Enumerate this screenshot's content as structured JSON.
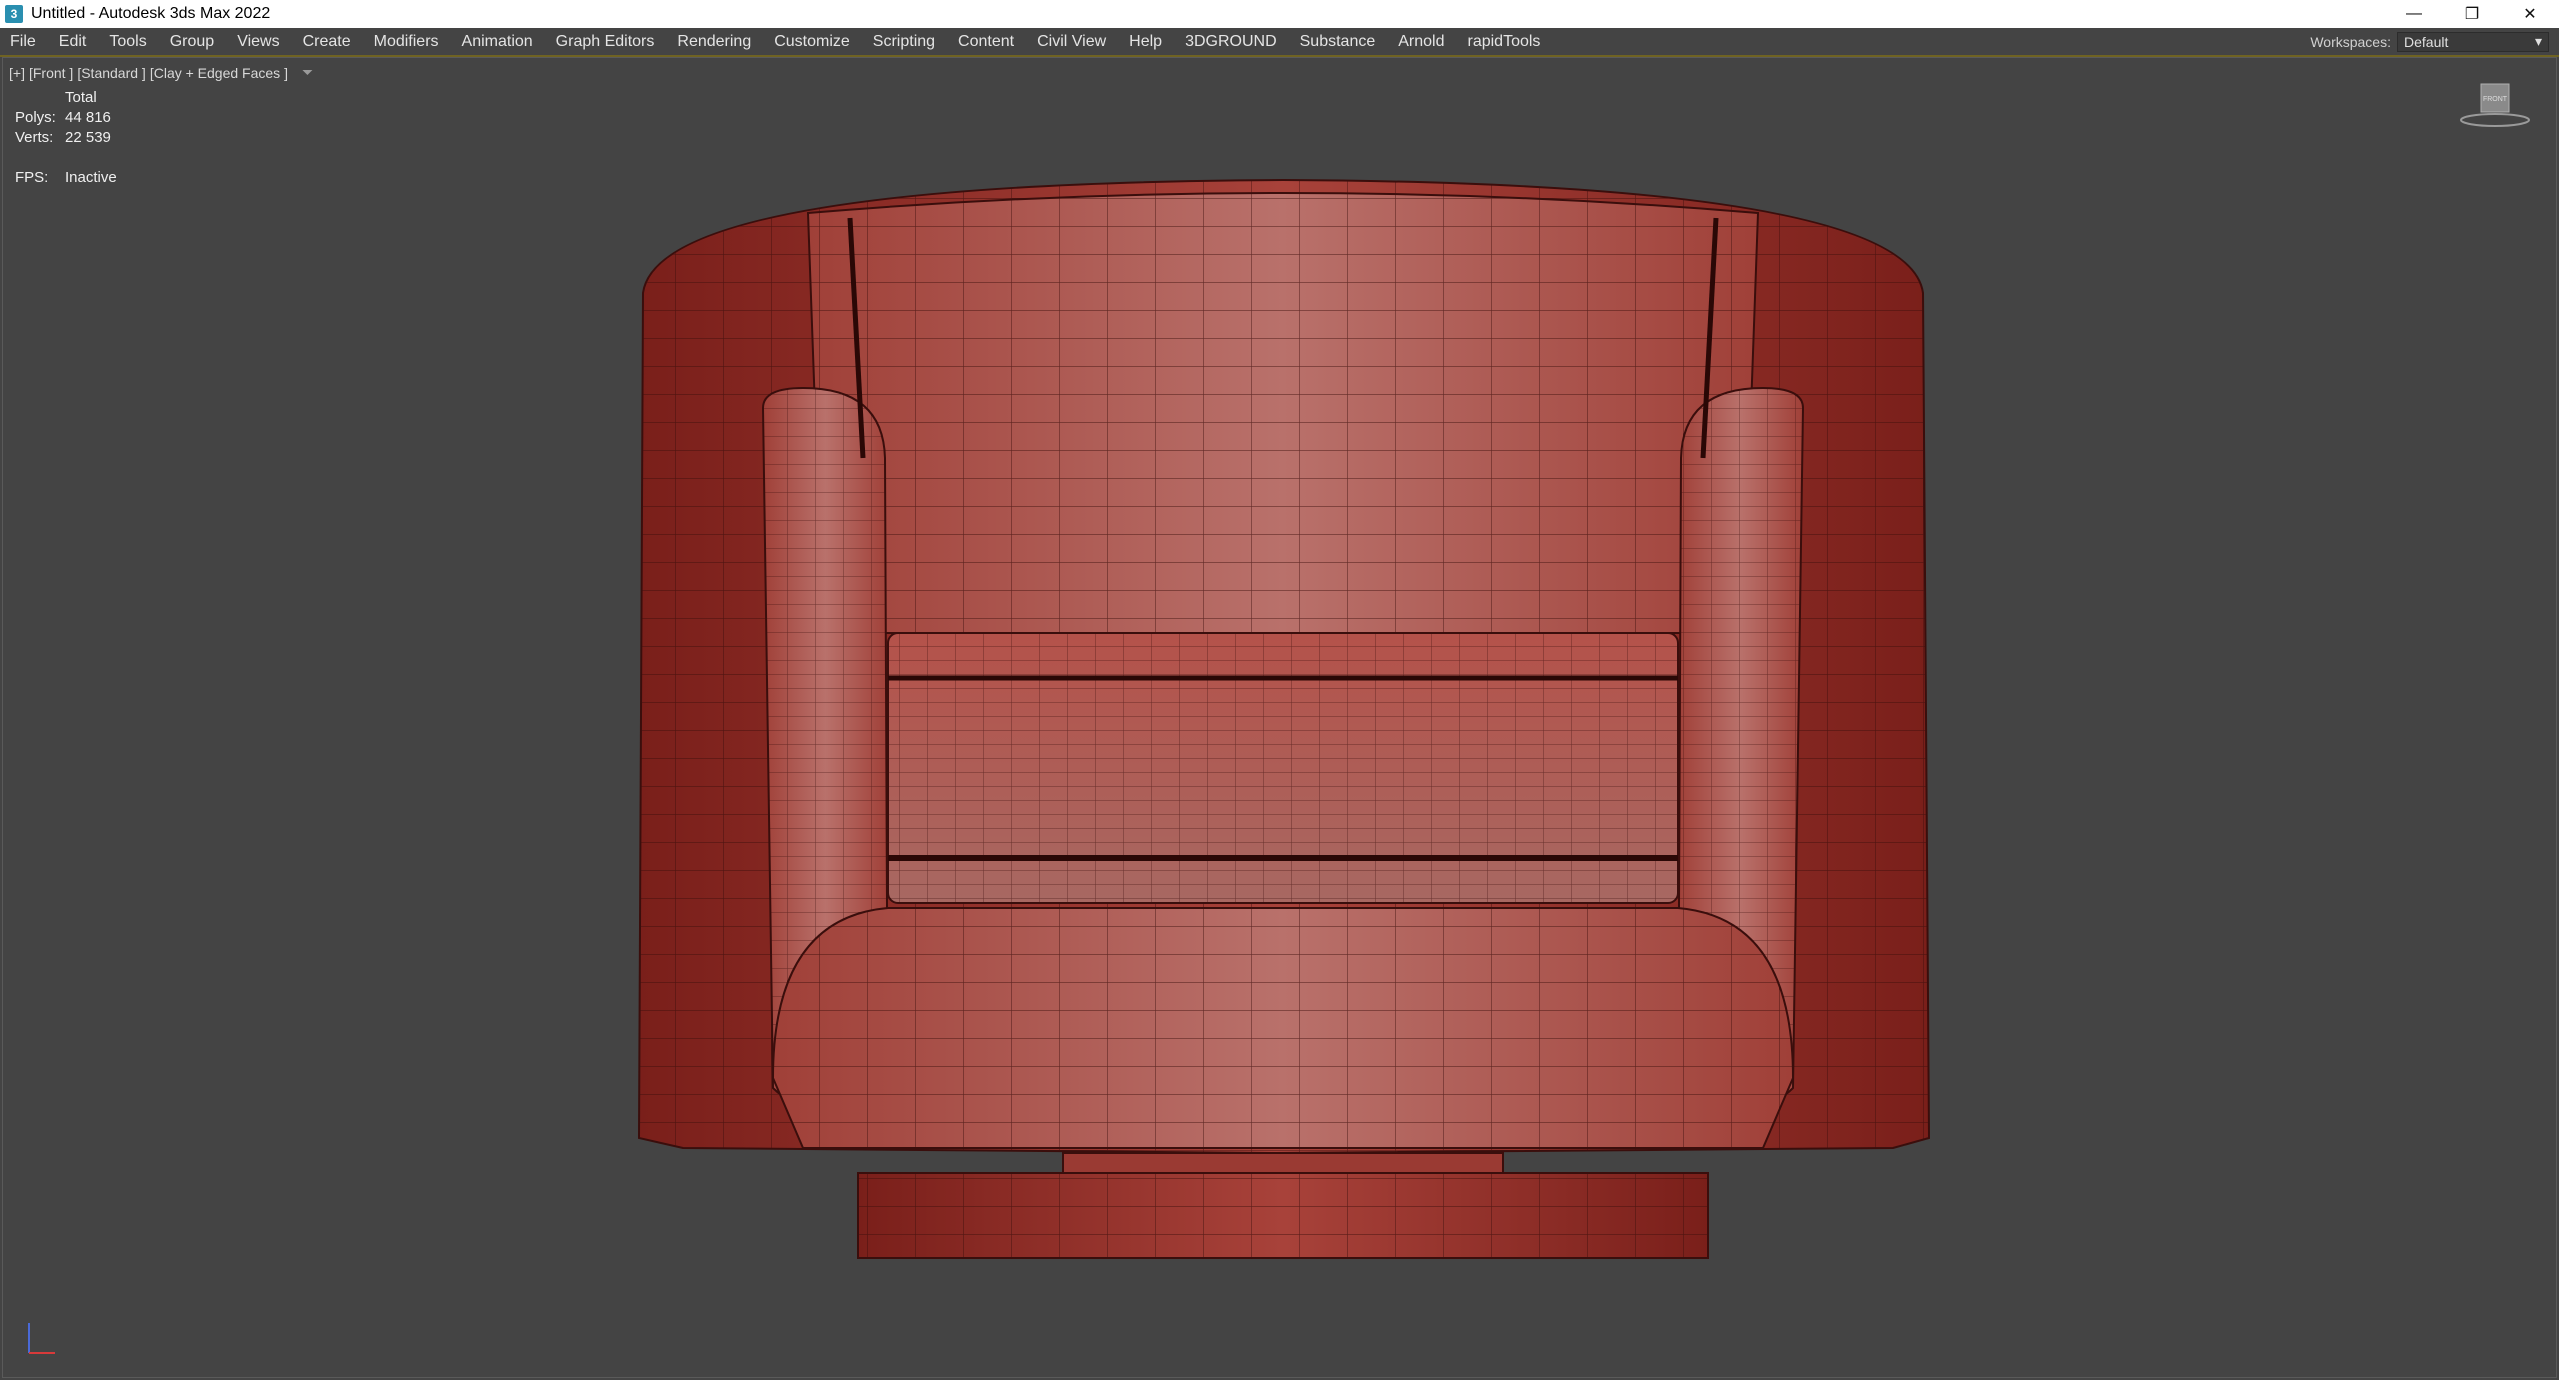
{
  "window": {
    "title": "Untitled - Autodesk 3ds Max 2022",
    "app_icon": "3",
    "controls": [
      "—",
      "❐",
      "✕"
    ]
  },
  "menu": [
    "File",
    "Edit",
    "Tools",
    "Group",
    "Views",
    "Create",
    "Modifiers",
    "Animation",
    "Graph Editors",
    "Rendering",
    "Customize",
    "Scripting",
    "Content",
    "Civil View",
    "Help",
    "3DGROUND",
    "Substance",
    "Arnold",
    "rapidTools"
  ],
  "workspaces": {
    "label": "Workspaces:",
    "value": "Default"
  },
  "viewport": {
    "labels": [
      "[+]",
      "[Front ]",
      "[Standard ]",
      "[Clay + Edged Faces ]"
    ],
    "stats": {
      "header": "Total",
      "polys_label": "Polys:",
      "polys": "44 816",
      "verts_label": "Verts:",
      "verts": "22 539",
      "fps_label": "FPS:",
      "fps": "Inactive"
    },
    "viewcube_label": "FRONT"
  },
  "colors": {
    "clay": "#a8423a",
    "wire": "#3a0e0c",
    "bg": "#444444"
  }
}
